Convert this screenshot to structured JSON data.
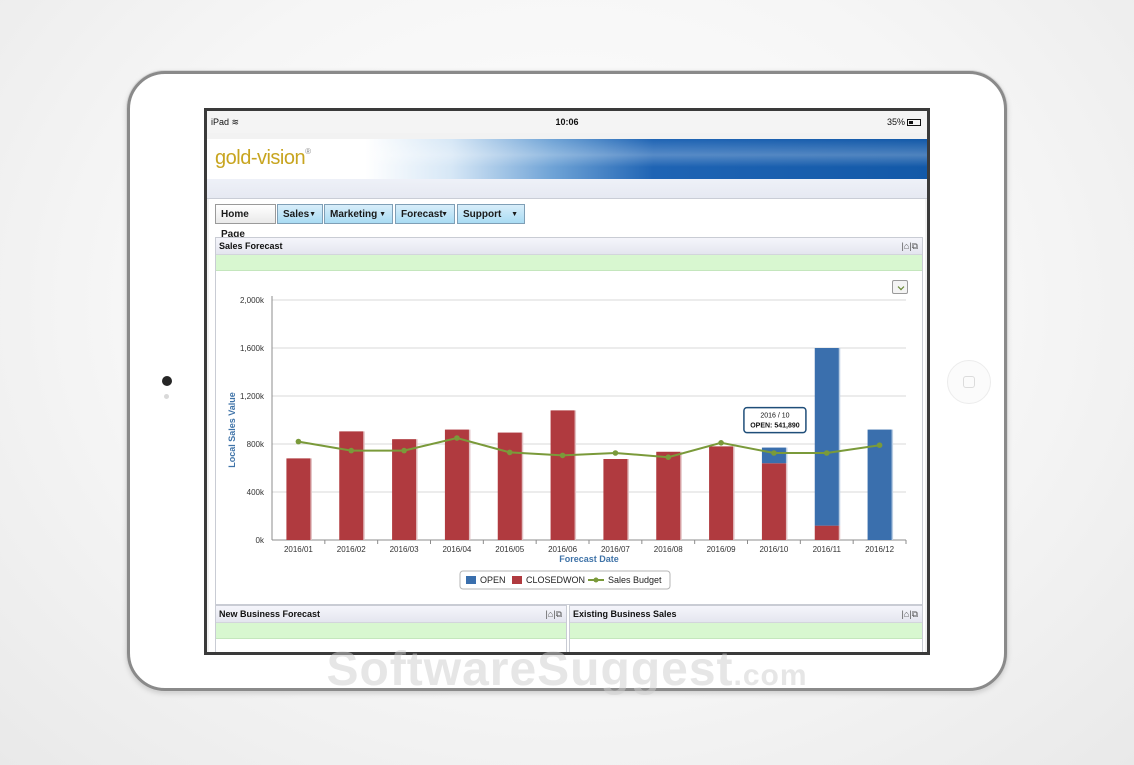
{
  "device": {
    "status_left": "iPad",
    "status_time": "10:06",
    "status_battery": "35%"
  },
  "app": {
    "logo_text": "gold-vision",
    "logo_mark": "®"
  },
  "nav": {
    "home": "Home Page",
    "sales": "Sales",
    "marketing": "Marketing",
    "forecast": "Forecast",
    "support": "Support",
    "caret": "▼"
  },
  "panels": {
    "sales_forecast": "Sales Forecast",
    "new_business": "New Business Forecast",
    "existing_business": "Existing Business Sales",
    "tools": "|⌂|⧉"
  },
  "watermark": {
    "main": "SoftwareSuggest",
    "suffix": ".com"
  },
  "colors": {
    "open": "#3a6fad",
    "closedwon": "#b03a3f",
    "budget": "#7a9a3a",
    "axis_label": "#3f73a8"
  },
  "chart_data": {
    "type": "bar",
    "title": "",
    "xlabel": "Forecast Date",
    "ylabel": "Local Sales Value",
    "ylim": [
      0,
      2000000
    ],
    "y_ticks": [
      "0k",
      "400k",
      "800k",
      "1,200k",
      "1,600k",
      "2,000k"
    ],
    "y_tick_values": [
      0,
      400000,
      800000,
      1200000,
      1600000,
      2000000
    ],
    "categories": [
      "2016/01",
      "2016/02",
      "2016/03",
      "2016/04",
      "2016/05",
      "2016/06",
      "2016/07",
      "2016/08",
      "2016/09",
      "2016/10",
      "2016/11",
      "2016/12"
    ],
    "stacked": true,
    "grid": true,
    "legend_position": "bottom",
    "series": [
      {
        "name": "CLOSEDWON",
        "kind": "bar",
        "values": [
          680000,
          905000,
          840000,
          920000,
          895000,
          1080000,
          675000,
          735000,
          780000,
          640000,
          120000,
          0
        ]
      },
      {
        "name": "OPEN",
        "kind": "bar",
        "values": [
          0,
          0,
          0,
          0,
          0,
          0,
          0,
          0,
          0,
          130000,
          1480000,
          920000
        ]
      },
      {
        "name": "Sales Budget",
        "kind": "line",
        "values": [
          820000,
          745000,
          745000,
          850000,
          730000,
          705000,
          725000,
          690000,
          810000,
          725000,
          725000,
          790000
        ]
      }
    ],
    "tooltip": {
      "category": "2016 / 10",
      "text": "OPEN: 541,890"
    }
  }
}
